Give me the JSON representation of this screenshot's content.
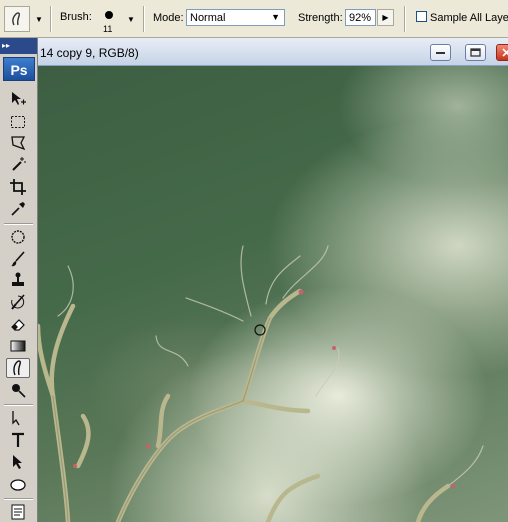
{
  "options_bar": {
    "brush_label": "Brush:",
    "brush_size": "11",
    "mode_label": "Mode:",
    "mode_value": "Normal",
    "strength_label": "Strength:",
    "strength_value": "92%",
    "sample_all_layers_label": "Sample All Layers",
    "sample_all_layers_checked": false
  },
  "toolbox": {
    "logo": "Ps",
    "grip": "▸▸",
    "tools": [
      "move-tool",
      "marquee-tool",
      "lasso-tool",
      "magic-wand-tool",
      "crop-tool",
      "eyedropper-tool",
      "healing-brush-tool",
      "brush-tool",
      "clone-stamp-tool",
      "history-brush-tool",
      "eraser-tool",
      "gradient-tool",
      "smudge-tool",
      "burn-tool",
      "pen-tool",
      "type-tool",
      "path-selection-tool",
      "ellipse-tool",
      "notes-tool"
    ],
    "active_tool": "smudge-tool"
  },
  "document": {
    "title": "14 copy 9, RGB/8)"
  },
  "colors": {
    "sky_dark": "#3d5e42",
    "cloud_light": "#eef0e0",
    "branch": "#b9b78e",
    "bud": "#c4646a"
  }
}
